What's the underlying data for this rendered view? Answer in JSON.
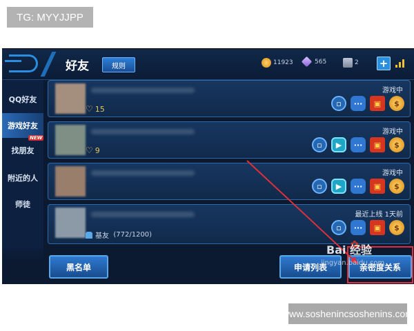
{
  "overlay": {
    "tg_label": "TG: MYYJJPP",
    "site_label": "www.soshenincsoshenins.com"
  },
  "header": {
    "title": "好友",
    "rules_button": "规则"
  },
  "resources": [
    {
      "name": "gold-coin",
      "value": "11923"
    },
    {
      "name": "diamond",
      "value": "565"
    },
    {
      "name": "ticket",
      "value": "2"
    }
  ],
  "add_button": "+",
  "sidebar": {
    "items": [
      {
        "label": "QQ好友"
      },
      {
        "label": "游戏好友"
      },
      {
        "label": "找朋友",
        "badge": "NEW"
      },
      {
        "label": "附近的人"
      },
      {
        "label": "师徒"
      }
    ],
    "active_index": 1
  },
  "friends": [
    {
      "status": "游戏中",
      "intimacy": "15",
      "icons": [
        "square-icon",
        "chat-icon",
        "gift-icon",
        "coin-icon"
      ]
    },
    {
      "status": "游戏中",
      "intimacy": "9",
      "icons": [
        "square-icon",
        "play-icon",
        "chat-icon",
        "gift-icon",
        "coin-icon"
      ]
    },
    {
      "status": "游戏中",
      "icons": [
        "square-icon",
        "play-icon",
        "chat-icon",
        "gift-icon",
        "coin-icon"
      ]
    },
    {
      "status": "最近上线  1天前",
      "relation_label": "基友",
      "relation_count": "(772/1200)",
      "icons": [
        "square-icon",
        "chat-icon",
        "gift-icon",
        "coin-icon"
      ]
    }
  ],
  "bottom": {
    "blacklist": "黑名单",
    "requests": "申请列表",
    "intimacy_relations": "亲密度关系"
  },
  "watermark": {
    "brand": "Bai 经验",
    "url": "jingyan.baidu.com"
  },
  "colors": {
    "highlight_box": "#e0303a",
    "accent": "#2a8fe0",
    "panel": "#0b1a30"
  }
}
